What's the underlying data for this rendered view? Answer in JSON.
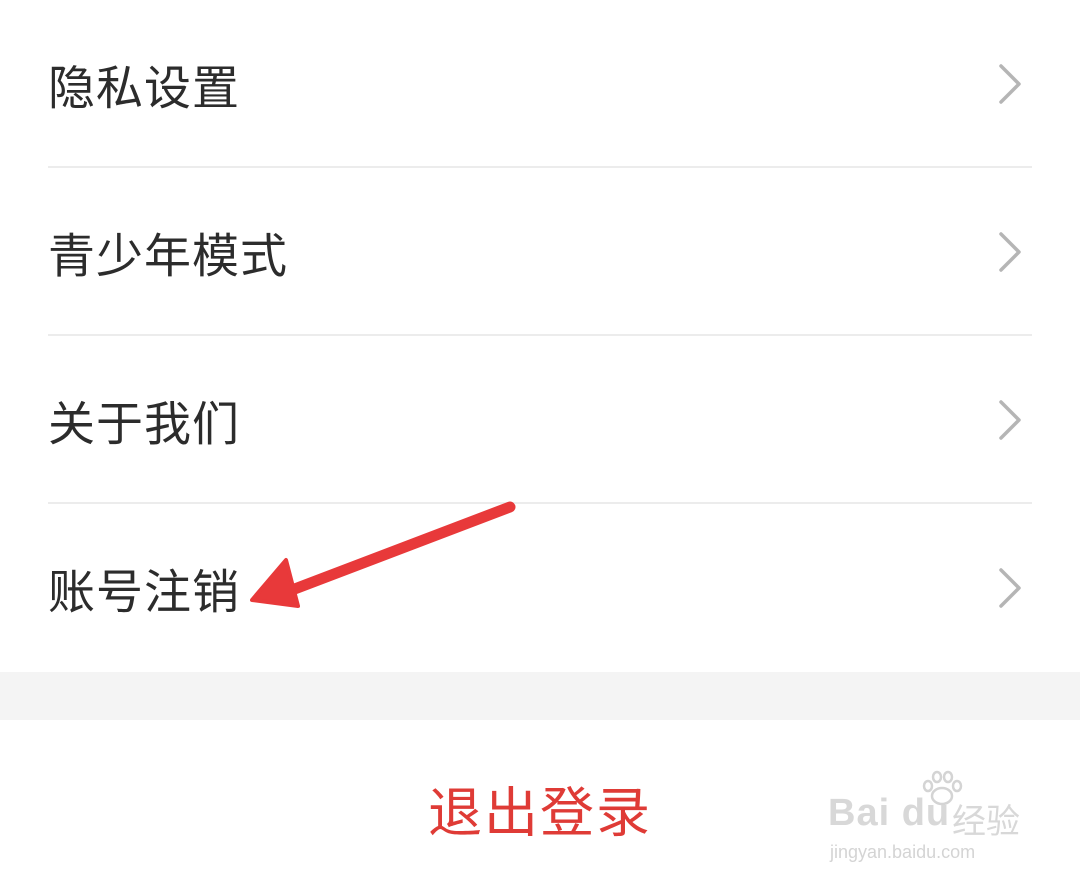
{
  "menu": {
    "items": [
      {
        "label": "隐私设置",
        "icon": "chevron-right-icon"
      },
      {
        "label": "青少年模式",
        "icon": "chevron-right-icon"
      },
      {
        "label": "关于我们",
        "icon": "chevron-right-icon"
      },
      {
        "label": "账号注销",
        "icon": "chevron-right-icon"
      }
    ]
  },
  "logout": {
    "label": "退出登录"
  },
  "annotation": {
    "icon": "red-arrow-icon",
    "color": "#e8393a"
  },
  "watermark": {
    "logo_text": "Bai du",
    "product": "经验",
    "url": "jingyan.baidu.com"
  },
  "colors": {
    "text": "#2c2c2c",
    "logout": "#df3b36",
    "divider": "#ececec",
    "chevron": "#b5b5b5",
    "gap": "#f4f4f4"
  }
}
